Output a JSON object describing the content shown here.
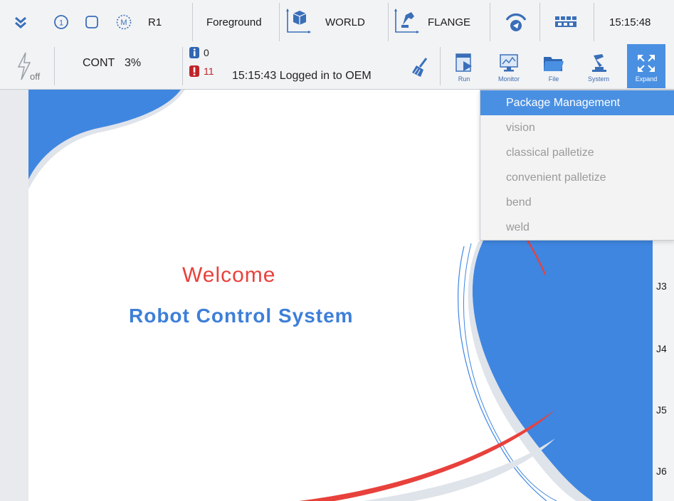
{
  "topbar": {
    "robot": "R1",
    "mode": "Foreground",
    "coord": "WORLD",
    "tool": "FLANGE",
    "time": "15:15:48"
  },
  "secondbar": {
    "power": "off",
    "run_mode": "CONT",
    "speed": "3%",
    "info_count": "0",
    "error_count": "11",
    "message": "15:15:43 Logged in to OEM",
    "tools": [
      {
        "label": "Run",
        "icon": "run-icon"
      },
      {
        "label": "Monitor",
        "icon": "monitor-icon"
      },
      {
        "label": "File",
        "icon": "folder-icon"
      },
      {
        "label": "System",
        "icon": "robot-arm-icon"
      },
      {
        "label": "Expand",
        "icon": "expand-icon"
      }
    ]
  },
  "dropdown": {
    "items": [
      "Package Management",
      "vision",
      "classical palletize",
      "convenient palletize",
      "bend",
      "weld"
    ]
  },
  "main": {
    "welcome": "Welcome",
    "subtitle": "Robot Control System"
  },
  "joints": [
    "J3",
    "J4",
    "J5",
    "J6"
  ],
  "colors": {
    "accent_blue": "#4a90e2",
    "brand_red": "#e8413c",
    "brand_blue": "#3d7fd8"
  }
}
